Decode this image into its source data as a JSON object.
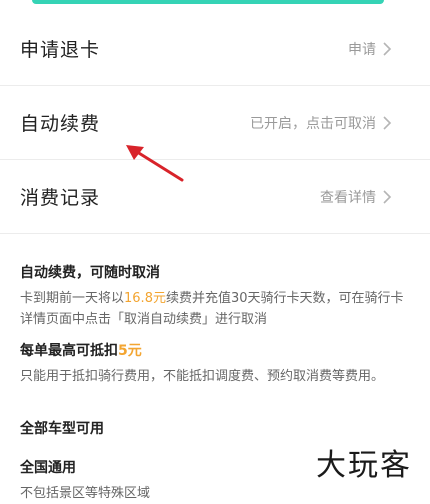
{
  "rows": [
    {
      "label": "申请退卡",
      "action": "申请"
    },
    {
      "label": "自动续费",
      "action": "已开启，点击可取消"
    },
    {
      "label": "消费记录",
      "action": "查看详情"
    }
  ],
  "info": {
    "auto_title": "自动续费，可随时取消",
    "auto_desc_pre": "卡到期前一天将以",
    "auto_desc_price": "16.8元",
    "auto_desc_post": "续费并充值30天骑行卡天数，可在骑行卡详情页面中点击「取消自动续费」进行取消",
    "max_title_pre": "每单最高可抵扣",
    "max_title_amount": "5元",
    "max_desc": "只能用于抵扣骑行费用，不能抵扣调度费、预约取消费等费用。",
    "all_models": "全部车型可用",
    "nation_title": "全国通用",
    "nation_desc": "不包括景区等特殊区域"
  },
  "watermark": "大玩客",
  "colors": {
    "accent_teal": "#35d3b5",
    "highlight": "#f3a531",
    "arrow": "#d8232a"
  }
}
